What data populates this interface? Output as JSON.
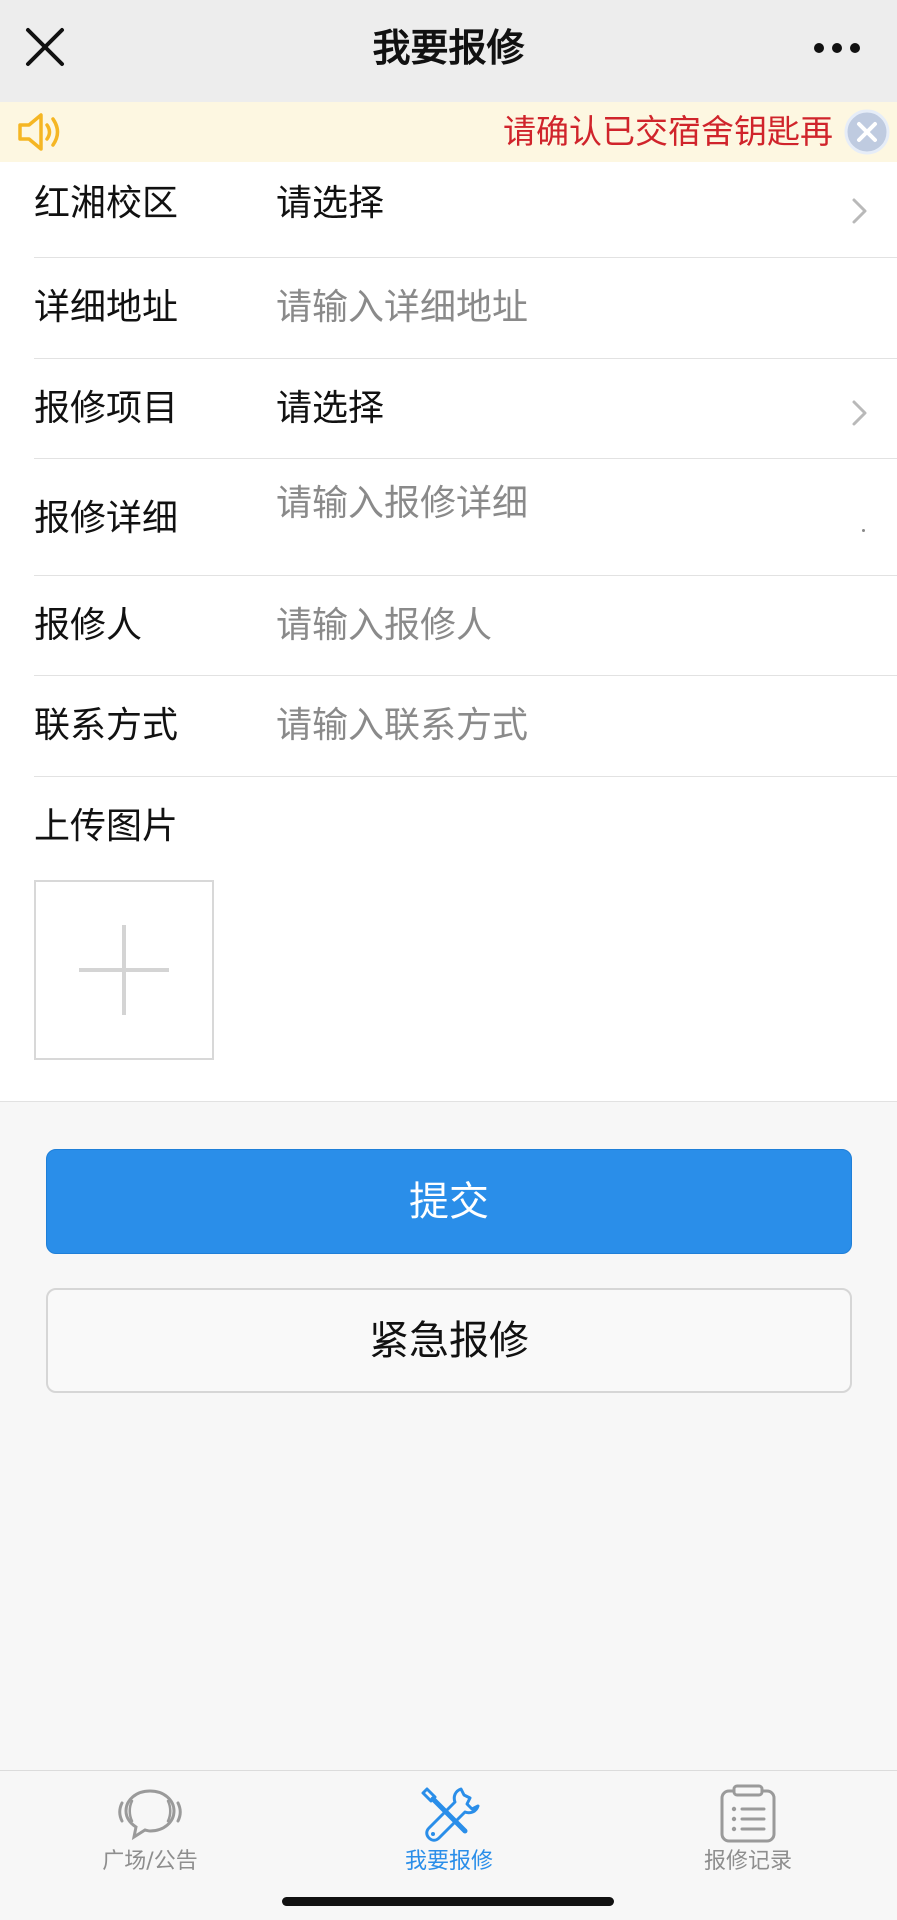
{
  "header": {
    "title": "我要报修",
    "close_icon": "close-icon",
    "more_icon": "more-icon"
  },
  "notice": {
    "text": "请确认已交宿舍钥匙再",
    "icon": "speaker-icon",
    "close_icon": "close-circle-icon"
  },
  "form": {
    "campus": {
      "label": "红湘校区",
      "value": "请选择"
    },
    "address": {
      "label": "详细地址",
      "placeholder": "请输入详细地址"
    },
    "item": {
      "label": "报修项目",
      "value": "请选择"
    },
    "detail": {
      "label": "报修详细",
      "placeholder": "请输入报修详细"
    },
    "reporter": {
      "label": "报修人",
      "placeholder": "请输入报修人"
    },
    "contact": {
      "label": "联系方式",
      "placeholder": "请输入联系方式"
    },
    "upload": {
      "label": "上传图片"
    }
  },
  "buttons": {
    "submit": "提交",
    "urgent": "紧急报修"
  },
  "tabs": [
    {
      "label": "广场/公告",
      "icon": "chat-bubble-icon"
    },
    {
      "label": "我要报修",
      "icon": "tools-icon"
    },
    {
      "label": "报修记录",
      "icon": "clipboard-list-icon"
    }
  ],
  "colors": {
    "accent": "#2a8ee9",
    "notice_text": "#d0242b",
    "notice_bg": "#fdf7e1",
    "speaker": "#f5b623"
  }
}
